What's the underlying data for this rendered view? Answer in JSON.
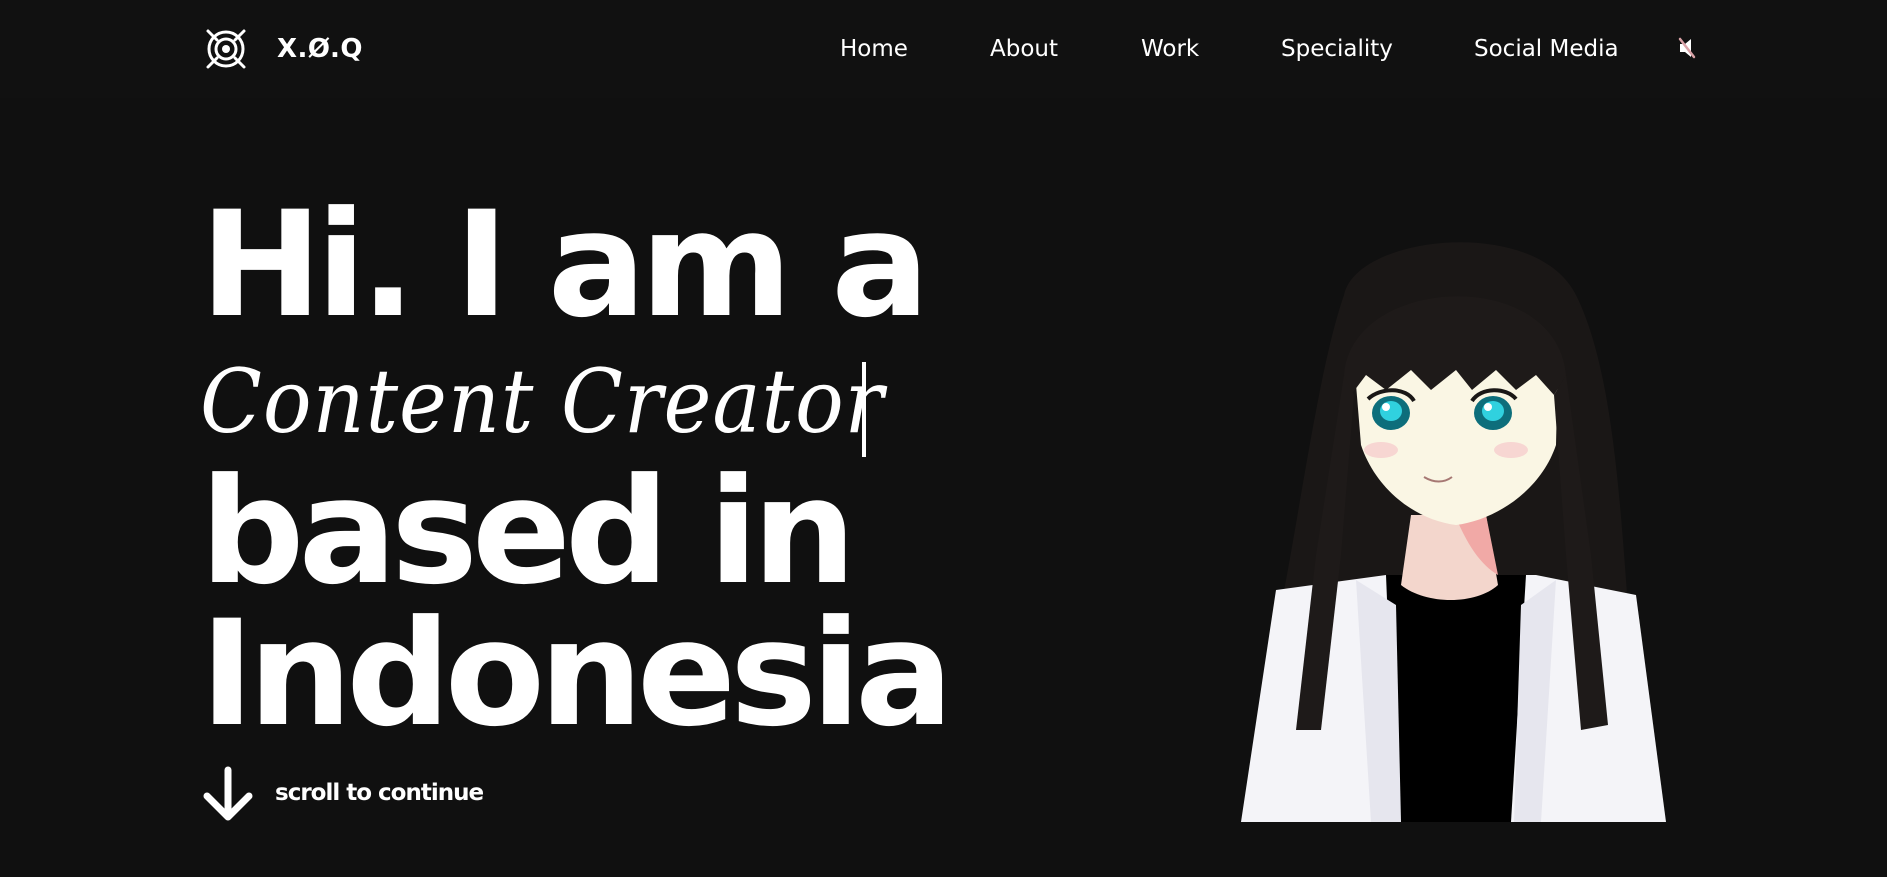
{
  "header": {
    "brand": "X.Ø.Q",
    "logo_icon": "target-eye-logo-icon",
    "nav": {
      "home": "Home",
      "about": "About",
      "work": "Work",
      "speciality": "Speciality",
      "social_media": "Social Media"
    },
    "audio_icon": "muted-speaker-icon"
  },
  "hero": {
    "line1": "Hi. I am a",
    "role": "Content Creator",
    "line3": "based in",
    "line4": "Indonesia"
  },
  "scroll": {
    "label": "scroll to continue",
    "icon": "arrow-down-icon"
  },
  "colors": {
    "background": "#101010",
    "text": "#ffffff",
    "mute_accent": "#d9a2a7"
  }
}
